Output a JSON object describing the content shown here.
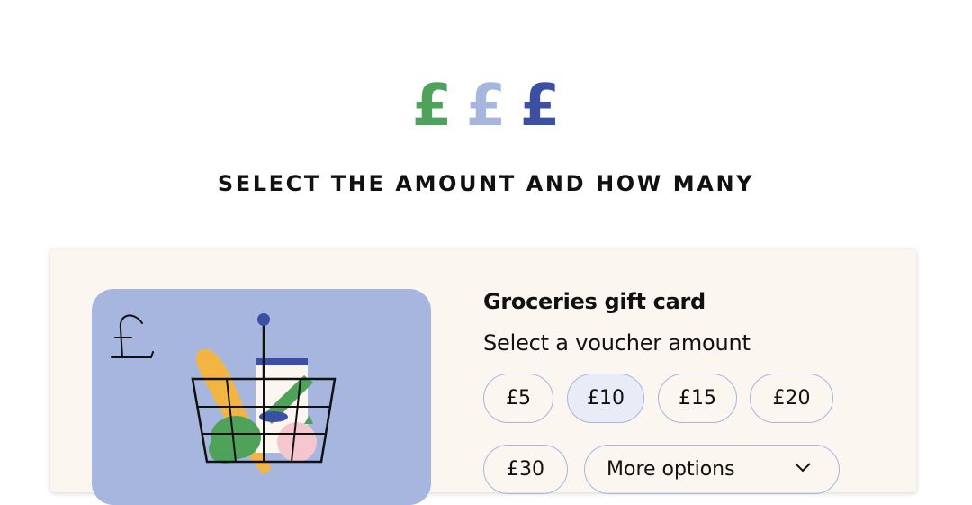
{
  "hero": {
    "icons": [
      {
        "name": "pound-icon",
        "glyph": "£",
        "color": "#4ea25a"
      },
      {
        "name": "pound-icon",
        "glyph": "£",
        "color": "#a6b6df"
      },
      {
        "name": "pound-icon",
        "glyph": "£",
        "color": "#3b4fa3"
      }
    ]
  },
  "heading": "SELECT THE AMOUNT AND HOW MANY",
  "product": {
    "title": "Groceries gift card",
    "voucher_label": "Select a voucher amount",
    "card_icons": [
      "pound-icon",
      "grocery-basket-icon"
    ],
    "amounts": [
      {
        "label": "£5",
        "selected": false
      },
      {
        "label": "£10",
        "selected": true
      },
      {
        "label": "£15",
        "selected": false
      },
      {
        "label": "£20",
        "selected": false
      },
      {
        "label": "£30",
        "selected": false
      }
    ],
    "more_options_label": "More options"
  },
  "colors": {
    "green": "#4ea25a",
    "light_blue": "#a6b6df",
    "dark_blue": "#3b4fa3",
    "panel_bg": "#fbf6ef",
    "selected_bg": "#e9ecf7"
  }
}
